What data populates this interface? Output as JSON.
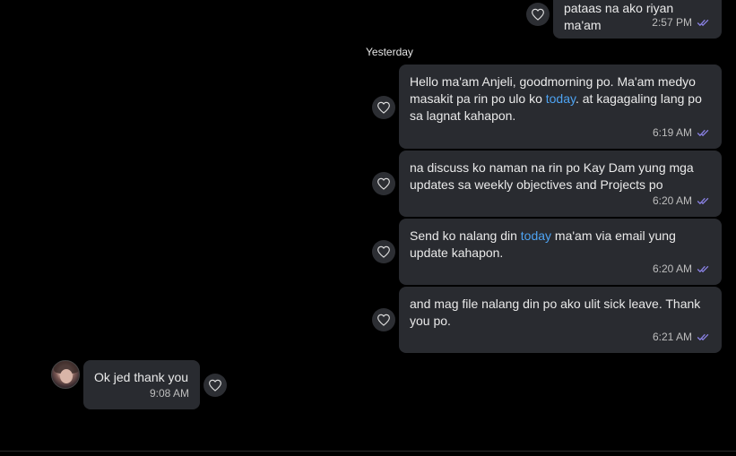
{
  "colors": {
    "background": "#000000",
    "bubble": "#292b30",
    "link": "#4ea3f2",
    "read_ticks": "#8b83e6",
    "meta_text": "#bdbdbd"
  },
  "date_separator": "Yesterday",
  "messages": [
    {
      "direction": "outgoing",
      "text_parts": [
        "pataas na ako riyan ma'am",
        "",
        ""
      ],
      "time": "2:57 PM",
      "status_icon": "double-check-icon"
    },
    {
      "direction": "outgoing",
      "text_parts": [
        "Hello ma'am Anjeli, goodmorning po. Ma'am medyo masakit pa rin po ulo ko ",
        "today",
        ". at kagagaling lang po sa lagnat kahapon."
      ],
      "time": "6:19 AM",
      "status_icon": "double-check-icon"
    },
    {
      "direction": "outgoing",
      "text_parts": [
        "na discuss ko naman na rin po Kay Dam yung mga updates sa weekly objectives and Projects po",
        "",
        ""
      ],
      "time": "6:20 AM",
      "status_icon": "double-check-icon"
    },
    {
      "direction": "outgoing",
      "text_parts": [
        "Send ko nalang din ",
        "today",
        " ma'am via email yung update kahapon."
      ],
      "time": "6:20 AM",
      "status_icon": "double-check-icon"
    },
    {
      "direction": "outgoing",
      "text_parts": [
        "and mag file nalang din po ako ulit sick leave. Thank you po.",
        "",
        ""
      ],
      "time": "6:21 AM",
      "status_icon": "double-check-icon"
    },
    {
      "direction": "incoming",
      "text_parts": [
        "Ok jed thank you",
        "",
        ""
      ],
      "time": "9:08 AM",
      "status_icon": ""
    }
  ],
  "icons": {
    "react": "heart-icon",
    "sender_avatar": "avatar"
  }
}
